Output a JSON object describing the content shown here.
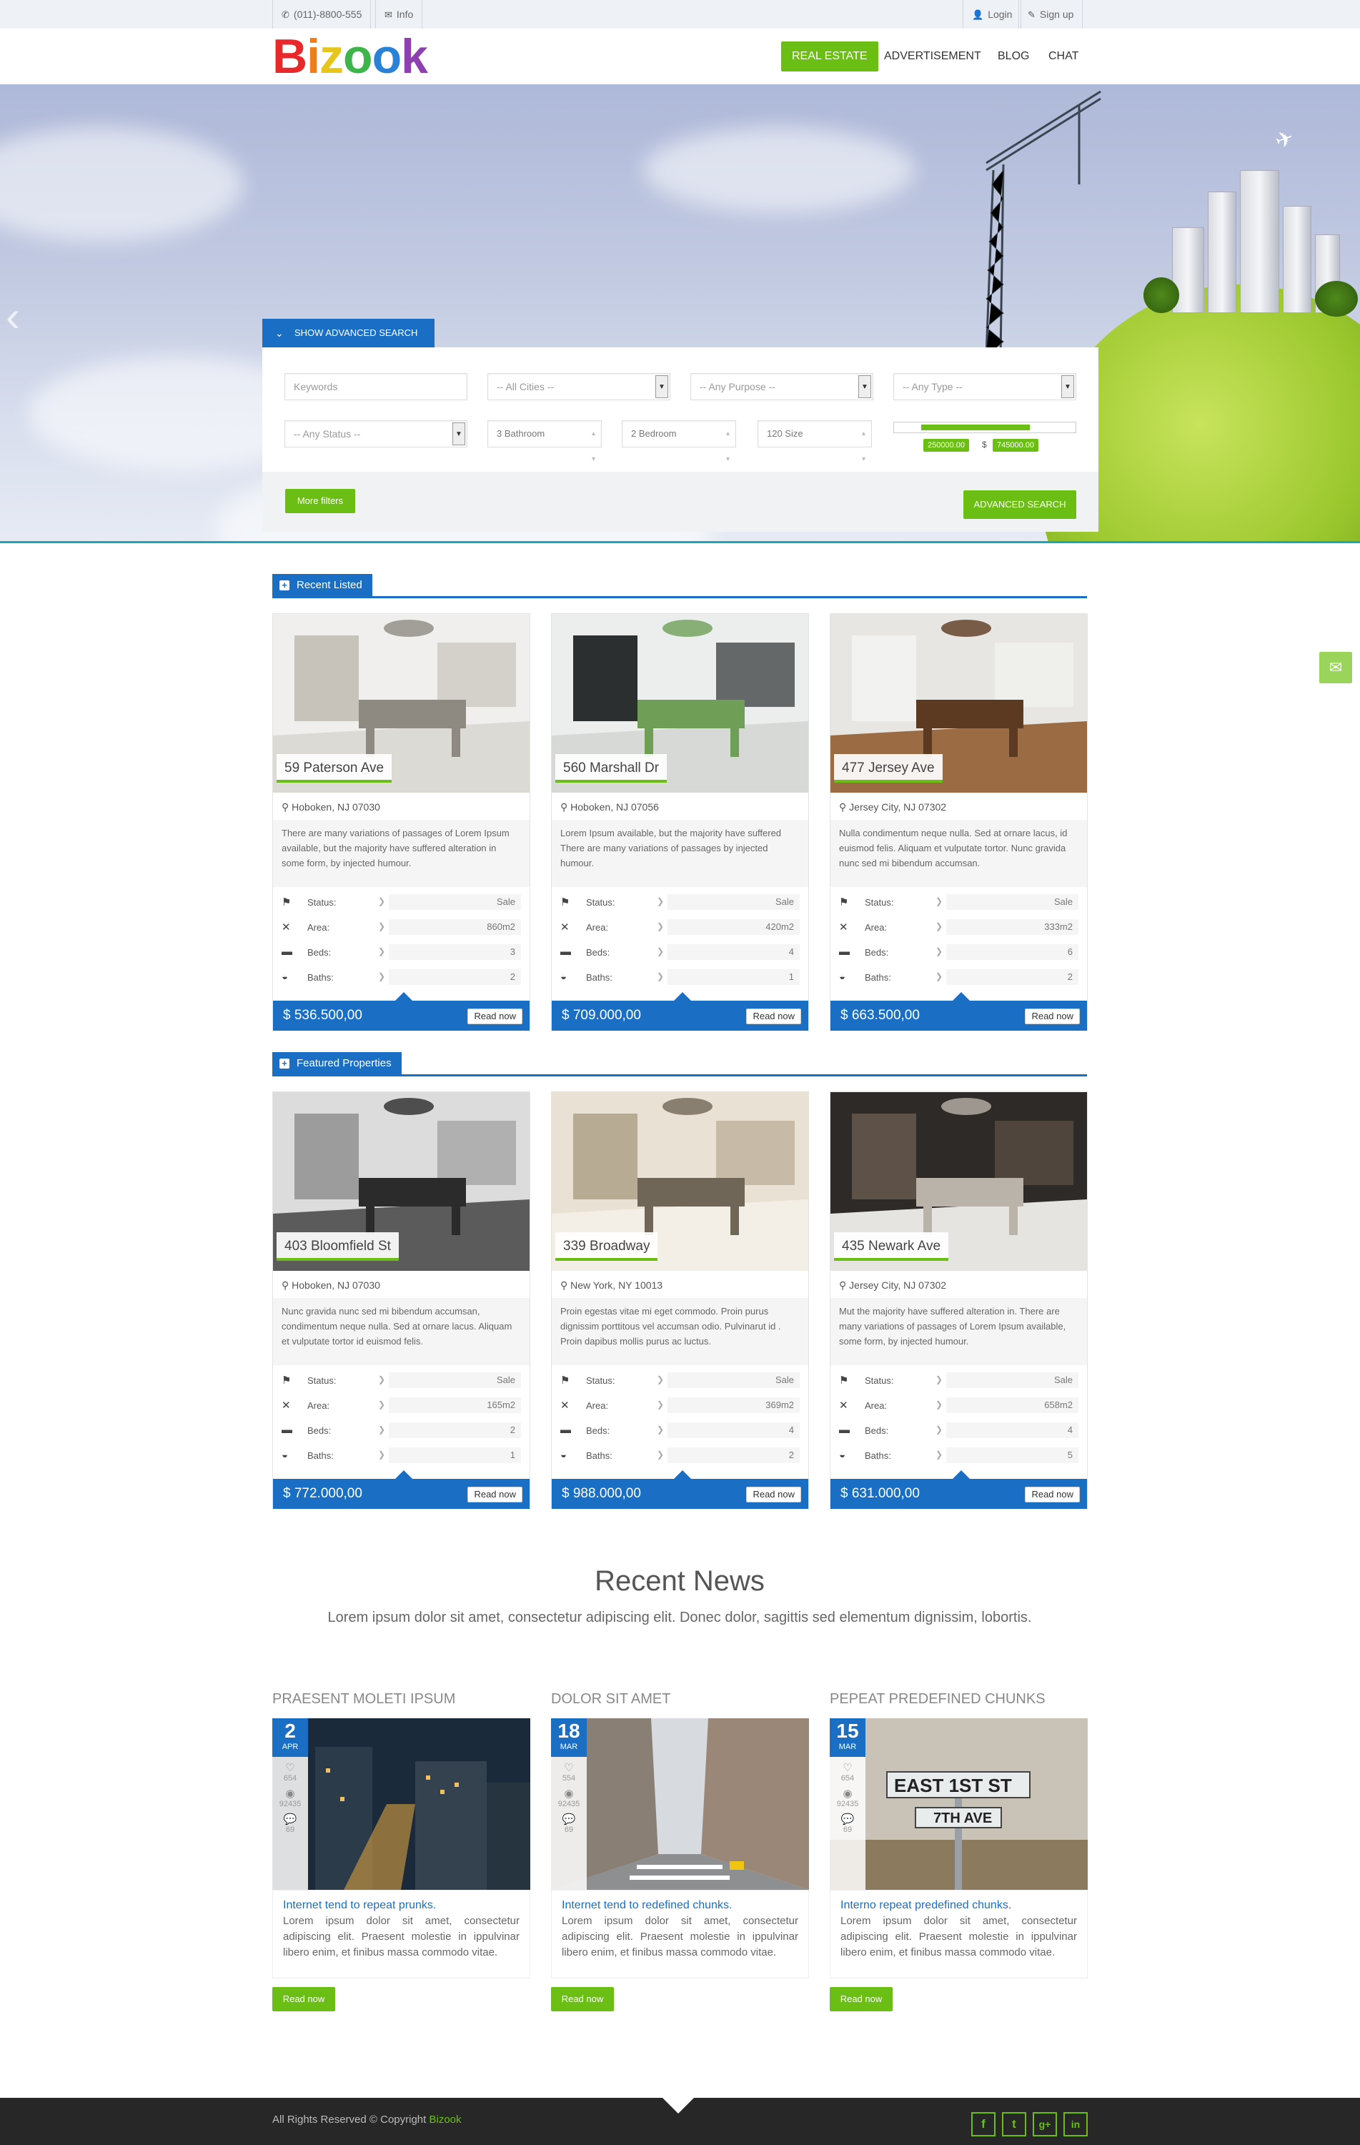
{
  "topbar": {
    "phone_icon": "phone-icon",
    "phone": "(011)-8800-555",
    "info_icon": "envelope-icon",
    "info": "Info",
    "login_icon": "user-icon",
    "login": "Login",
    "signup_icon": "edit-icon",
    "signup": "Sign up"
  },
  "header": {
    "logo": [
      "B",
      "i",
      "z",
      "o",
      "o",
      "k"
    ],
    "logo_colors": [
      "#e8282b",
      "#f07c1a",
      "#e8c51a",
      "#3db54a",
      "#2a82d6",
      "#8e3fb0"
    ],
    "nav": [
      "REAL ESTATE",
      "ADVERTISEMENT",
      "BLOG",
      "CHAT"
    ],
    "nav_active_color": "#6bbe13"
  },
  "search": {
    "toggle": "SHOW ADVANCED SEARCH",
    "keywords_placeholder": "Keywords",
    "cities": "-- All Cities --",
    "purpose": "-- Any Purpose --",
    "type": "-- Any Type --",
    "status": "-- Any Status --",
    "bathroom": "3  Bathroom",
    "bedroom": "2  Bedroom",
    "size": "120  Size",
    "range_min": "250000.00",
    "range_sep": "$",
    "range_max": "745000.00",
    "range_fill": [
      0.15,
      0.75
    ],
    "more_filters": "More filters",
    "advanced_search": "ADVANCED SEARCH"
  },
  "recent": {
    "title": "Recent Listed",
    "cards": [
      {
        "addr": "59 Paterson Ave",
        "city": "Hoboken, NJ 07030",
        "desc": "There are many variations of passages of Lorem Ipsum available, but the majority have suffered alteration in some form, by injected humour.",
        "status": "Sale",
        "area": "860m2",
        "beds": "3",
        "baths": "2",
        "price": "$ 536.500,00"
      },
      {
        "addr": "560 Marshall Dr",
        "city": "Hoboken, NJ 07056",
        "desc": "Lorem Ipsum available, but the majority have suffered There are many variations of passages by injected humour.",
        "status": "Sale",
        "area": "420m2",
        "beds": "4",
        "baths": "1",
        "price": "$ 709.000,00"
      },
      {
        "addr": "477 Jersey Ave",
        "city": "Jersey City, NJ 07302",
        "desc": "Nulla condimentum neque nulla. Sed at ornare lacus, id euismod felis. Aliquam et vulputate tortor. Nunc gravida nunc sed mi bibendum accumsan.",
        "status": "Sale",
        "area": "333m2",
        "beds": "6",
        "baths": "2",
        "price": "$ 663.500,00"
      }
    ]
  },
  "featured": {
    "title": "Featured Properties",
    "cards": [
      {
        "addr": "403 Bloomfield St",
        "city": "Hoboken, NJ 07030",
        "desc": "Nunc gravida nunc sed mi bibendum accumsan, condimentum neque nulla. Sed at ornare lacus. Aliquam et vulputate tortor id euismod felis.",
        "status": "Sale",
        "area": "165m2",
        "beds": "2",
        "baths": "1",
        "price": "$ 772.000,00"
      },
      {
        "addr": "339 Broadway",
        "city": "New York, NY 10013",
        "desc": "Proin egestas vitae mi eget commodo. Proin purus dignissim porttitous vel accumsan odio. Pulvinarut id . Proin dapibus mollis purus ac luctus.",
        "status": "Sale",
        "area": "369m2",
        "beds": "4",
        "baths": "2",
        "price": "$ 988.000,00"
      },
      {
        "addr": "435 Newark Ave",
        "city": "Jersey City, NJ 07302",
        "desc": "Mut the majority have suffered alteration in. There are many variations of passages of Lorem Ipsum available, some form, by injected humour.",
        "status": "Sale",
        "area": "658m2",
        "beds": "4",
        "baths": "5",
        "price": "$ 631.000,00"
      }
    ]
  },
  "labels": {
    "status": "Status:",
    "area": "Area:",
    "beds": "Beds:",
    "baths": "Baths:",
    "read_now": "Read now",
    "sep": "❯"
  },
  "news": {
    "title": "Recent News",
    "subtitle": "Lorem ipsum dolor sit amet, consectetur adipiscing elit. Donec dolor, sagittis sed elementum dignissim, lobortis.",
    "items": [
      {
        "head": "PRAESENT MOLETI IPSUM",
        "day": "2",
        "month": "APR",
        "likes": "654",
        "views": "92435",
        "comments": "69",
        "link": "Internet tend to repeat prunks.",
        "text": "Lorem ipsum dolor sit amet, consectetur adipiscing elit. Praesent molestie in ippulvinar libero enim, et finibus massa commodo vitae.",
        "read": "Read now"
      },
      {
        "head": "DOLOR SIT AMET",
        "day": "18",
        "month": "MAR",
        "likes": "554",
        "views": "92435",
        "comments": "69",
        "link": "Internet tend to redefined chunks.",
        "text": "Lorem ipsum dolor sit amet, consectetur adipiscing elit. Praesent molestie in ippulvinar libero enim, et finibus massa commodo vitae.",
        "read": "Read now"
      },
      {
        "head": "PEPEAT PREDEFINED CHUNKS",
        "day": "15",
        "month": "MAR",
        "likes": "654",
        "views": "92435",
        "comments": "69",
        "link": "Interno repeat predefined chunks.",
        "text": "Lorem ipsum dolor sit amet, consectetur adipiscing elit. Praesent molestie in ippulvinar libero enim, et finibus massa commodo vitae.",
        "read": "Read now"
      }
    ]
  },
  "street_sign": {
    "line1": "EAST 1ST ST",
    "line2": "7TH AVE"
  },
  "footer": {
    "copyright": "All Rights Reserved © Copyright",
    "brand": "Bizook",
    "social": [
      "f",
      "t",
      "g+",
      "in"
    ]
  }
}
